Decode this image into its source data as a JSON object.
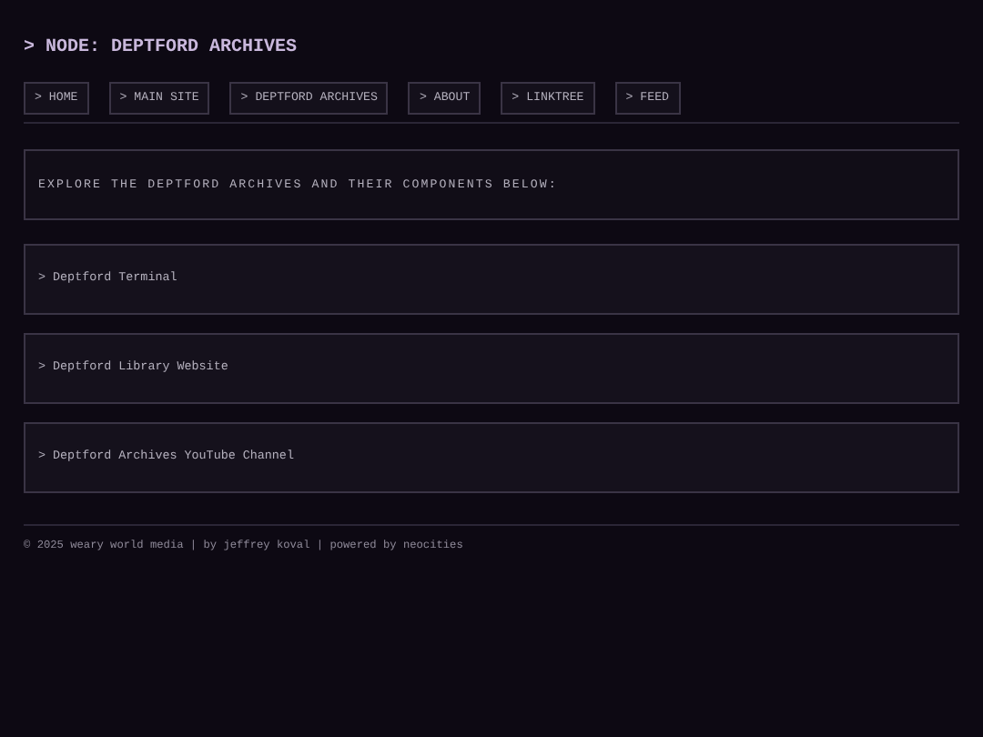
{
  "title": "> NODE: DEPTFORD ARCHIVES",
  "nav": [
    "> HOME",
    "> MAIN SITE",
    "> DEPTFORD ARCHIVES",
    "> ABOUT",
    "> LINKTREE",
    "> FEED"
  ],
  "intro": "EXPLORE THE DEPTFORD ARCHIVES AND THEIR COMPONENTS BELOW:",
  "links": [
    "> Deptford Terminal",
    "> Deptford Library Website",
    "> Deptford Archives YouTube Channel"
  ],
  "footer": "© 2025 weary world media | by jeffrey koval | powered by neocities"
}
